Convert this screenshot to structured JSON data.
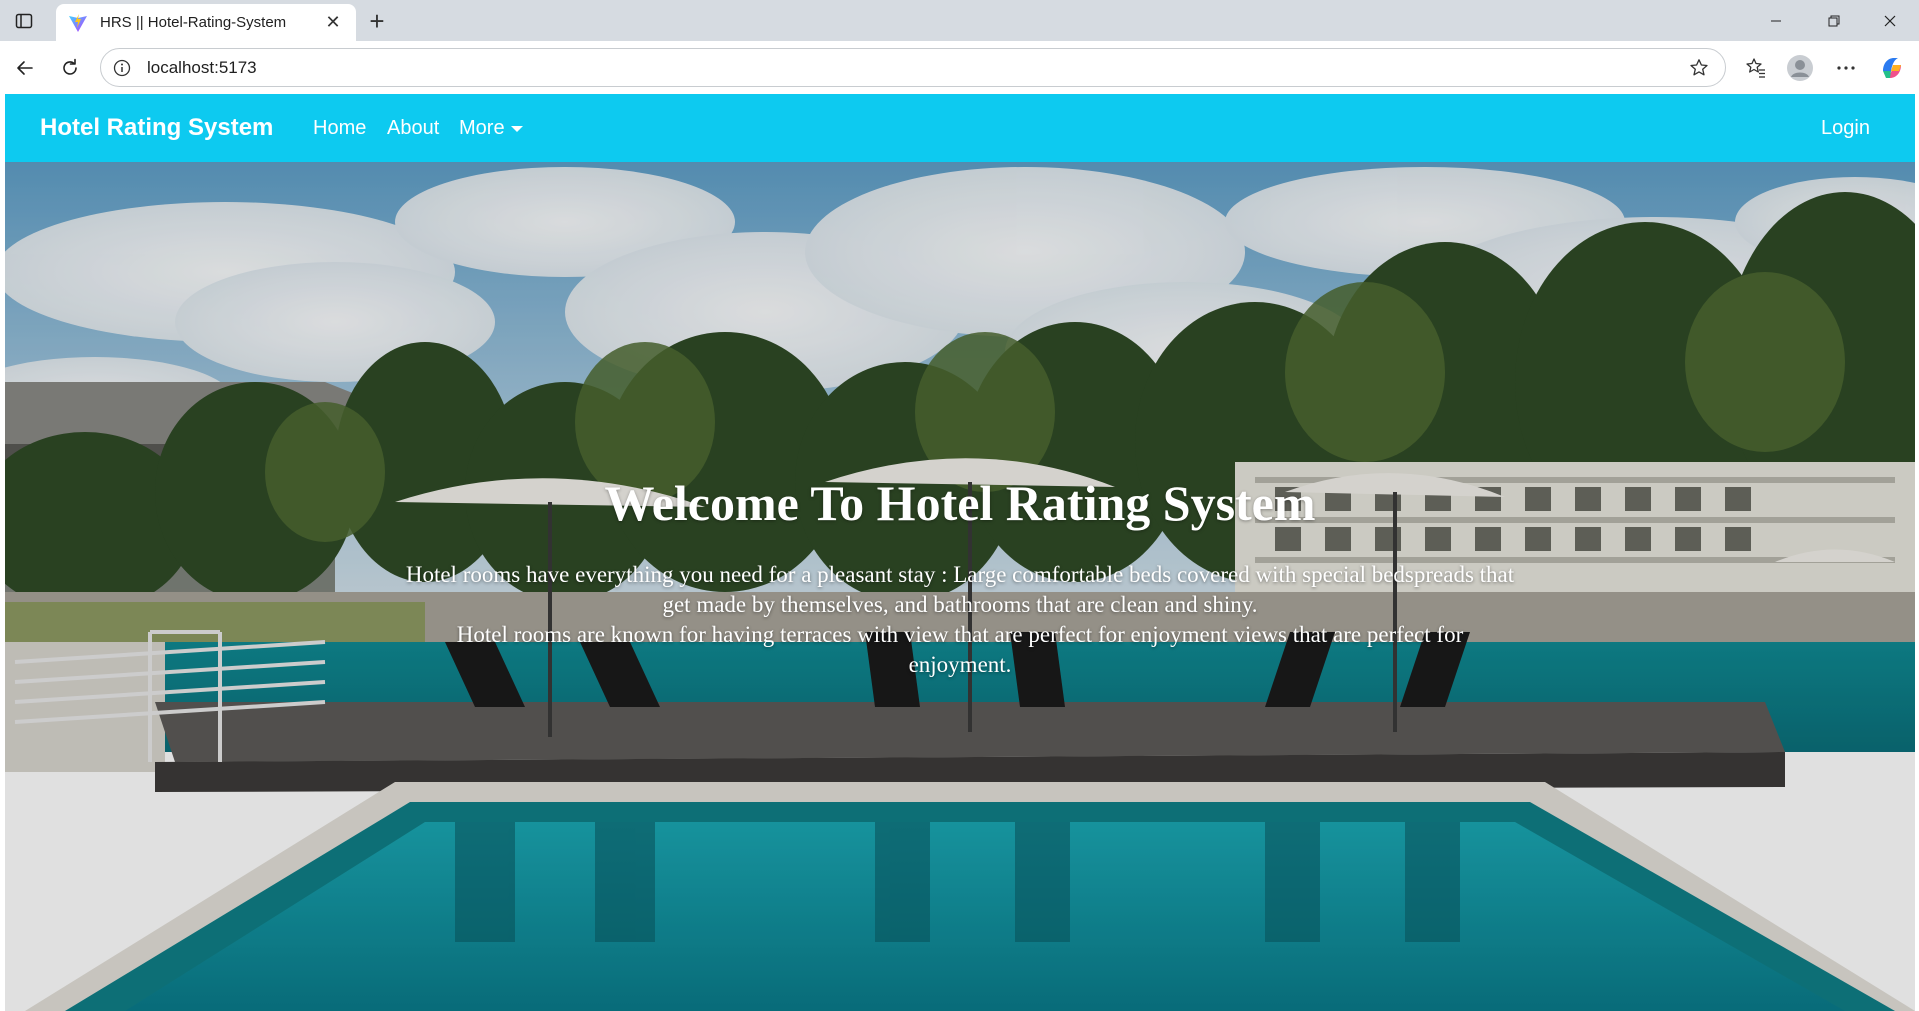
{
  "browser": {
    "tab": {
      "title": "HRS || Hotel-Rating-System",
      "favicon": "vite-logo-icon"
    },
    "new_tab_label": "+",
    "url": "localhost:5173"
  },
  "navbar": {
    "brand": "Hotel Rating System",
    "links": [
      {
        "label": "Home"
      },
      {
        "label": "About"
      },
      {
        "label": "More"
      }
    ],
    "login": "Login",
    "background_color": "#0dcaf0"
  },
  "hero": {
    "title": "Welcome To Hotel Rating System",
    "paragraph_1": "Hotel rooms have everything you need for a pleasant stay : Large comfortable beds covered with special bedspreads that get made by themselves, and bathrooms that are clean and shiny.",
    "paragraph_2": "Hotel rooms are known for having terraces with view that are perfect for enjoyment views that are perfect for enjoyment.",
    "background": "hotel-pool-photo"
  }
}
